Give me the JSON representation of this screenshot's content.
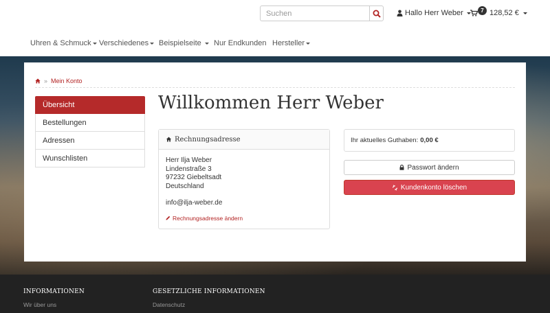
{
  "header": {
    "search": {
      "placeholder": "Suchen"
    },
    "user_label": "Hallo Herr Weber",
    "cart": {
      "count": "7",
      "total": "128,52 €"
    }
  },
  "nav": {
    "items": [
      {
        "label": "Uhren & Schmuck"
      },
      {
        "label": "Verschiedenes"
      },
      {
        "label": "Beispielseite"
      },
      {
        "label": "Nur Endkunden"
      },
      {
        "label": "Hersteller"
      }
    ]
  },
  "breadcrumb": {
    "current": "Mein Konto"
  },
  "sidebar": {
    "items": [
      {
        "label": "Übersicht"
      },
      {
        "label": "Bestellungen"
      },
      {
        "label": "Adressen"
      },
      {
        "label": "Wunschlisten"
      }
    ]
  },
  "main": {
    "title": "Willkommen Herr Weber",
    "address": {
      "heading": "Rechnungsadresse",
      "name": "Herr Ilja Weber",
      "street": "Lindenstraße 3",
      "city": "97232 Giebeltsadt",
      "country": "Deutschland",
      "email": "info@ilja-weber.de",
      "edit_label": "Rechnungsadresse ändern"
    },
    "credit": {
      "label": "Ihr aktuelles Guthaben:",
      "value": "0,00 €"
    },
    "password_button": "Passwort ändern",
    "delete_button": "Kundenkonto löschen"
  },
  "footer": {
    "col1": {
      "heading": "INFORMATIONEN",
      "link": "Wir über uns"
    },
    "col2": {
      "heading": "GESETZLICHE INFORMATIONEN",
      "link": "Datenschutz"
    }
  },
  "colors": {
    "accent": "#b52a2a",
    "danger": "#d9434f",
    "footer": "#222222"
  }
}
